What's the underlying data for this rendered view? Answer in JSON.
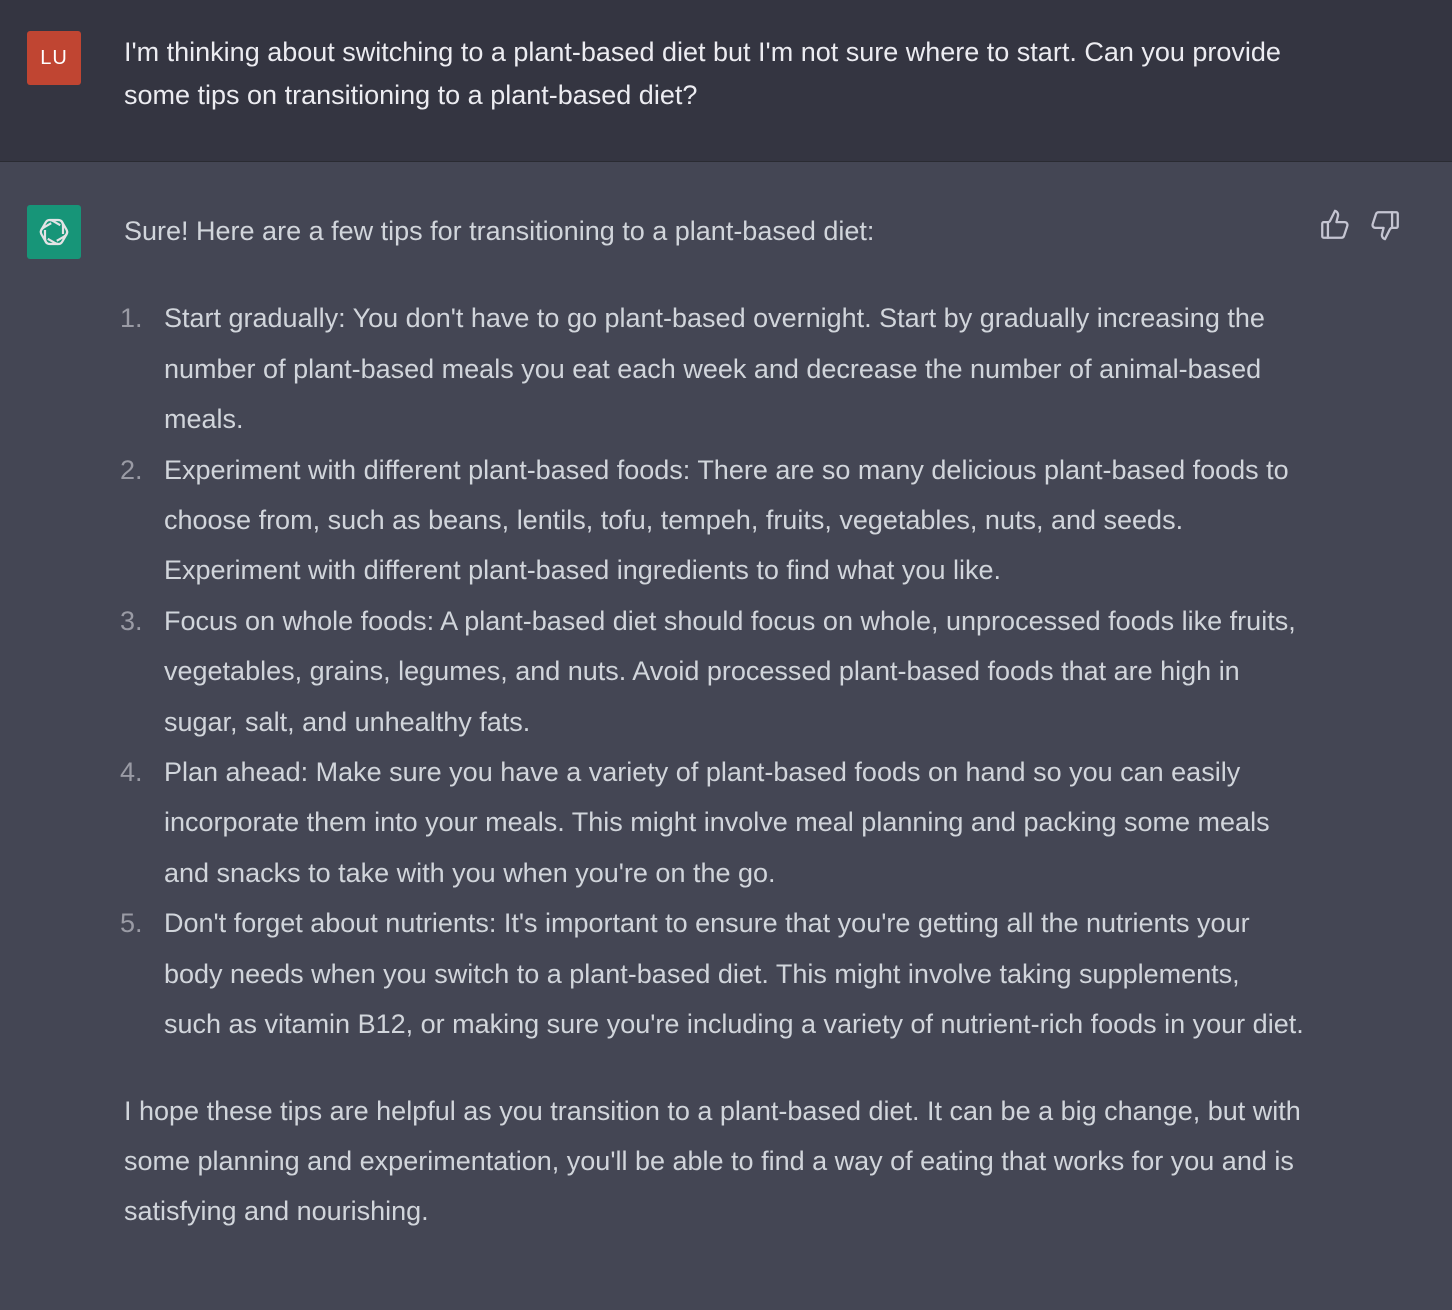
{
  "user_message": {
    "avatar_initials": "LU",
    "text": "I'm thinking about switching to a plant-based diet but I'm not sure where to start. Can you provide some tips on transitioning to a plant-based diet?"
  },
  "assistant_message": {
    "avatar_icon": "openai-logo-icon",
    "intro": "Sure! Here are a few tips for transitioning to a plant-based diet:",
    "tips": [
      {
        "number": "1.",
        "text": "Start gradually: You don't have to go plant-based overnight. Start by gradually increasing the number of plant-based meals you eat each week and decrease the number of animal-based meals."
      },
      {
        "number": "2.",
        "text": "Experiment with different plant-based foods: There are so many delicious plant-based foods to choose from, such as beans, lentils, tofu, tempeh, fruits, vegetables, nuts, and seeds. Experiment with different plant-based ingredients to find what you like."
      },
      {
        "number": "3.",
        "text": "Focus on whole foods: A plant-based diet should focus on whole, unprocessed foods like fruits, vegetables, grains, legumes, and nuts. Avoid processed plant-based foods that are high in sugar, salt, and unhealthy fats."
      },
      {
        "number": "4.",
        "text": "Plan ahead: Make sure you have a variety of plant-based foods on hand so you can easily incorporate them into your meals. This might involve meal planning and packing some meals and snacks to take with you when you're on the go."
      },
      {
        "number": "5.",
        "text": "Don't forget about nutrients: It's important to ensure that you're getting all the nutrients your body needs when you switch to a plant-based diet. This might involve taking supplements, such as vitamin B12, or making sure you're including a variety of nutrient-rich foods in your diet."
      }
    ],
    "outro": "I hope these tips are helpful as you transition to a plant-based diet. It can be a big change, but with some planning and experimentation, you'll be able to find a way of eating that works for you and is satisfying and nourishing."
  },
  "feedback": {
    "like_icon": "thumbs-up-icon",
    "dislike_icon": "thumbs-down-icon"
  },
  "colors": {
    "user_background": "#343541",
    "assistant_background": "#444654",
    "user_avatar": "#c04532",
    "assistant_avatar": "#10a37f"
  }
}
